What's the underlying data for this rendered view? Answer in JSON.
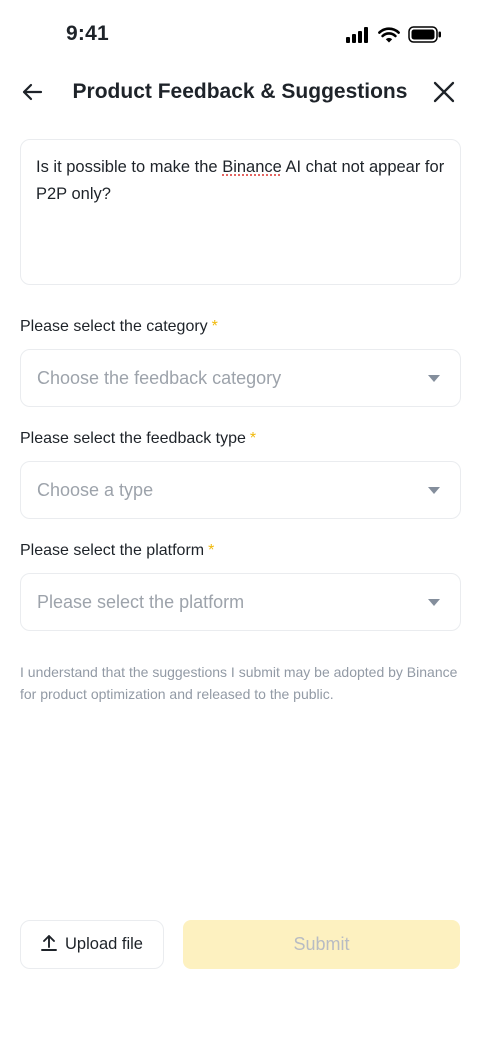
{
  "status_bar": {
    "time": "9:41"
  },
  "header": {
    "title": "Product Feedback & Suggestions",
    "back_icon": "arrow-left-icon",
    "close_icon": "close-icon"
  },
  "feedback": {
    "text_before": "Is it possible to make the ",
    "text_flagged": "Binance",
    "text_after": " AI chat not appear for P2P only?"
  },
  "fields": [
    {
      "label": "Please select the category",
      "required_mark": "*",
      "placeholder": "Choose the feedback category"
    },
    {
      "label": "Please select the feedback type",
      "required_mark": "*",
      "placeholder": "Choose a type"
    },
    {
      "label": "Please select the platform",
      "required_mark": "*",
      "placeholder": "Please select the platform"
    }
  ],
  "disclaimer": "I understand that the suggestions I submit may be adopted by Binance for product optimization and released to the public.",
  "actions": {
    "upload_label": "Upload file",
    "submit_label": "Submit"
  },
  "colors": {
    "accent": "#f0b90b",
    "submit_disabled_bg": "#fdf1c0",
    "border": "#eaecef",
    "placeholder": "#9da3ab"
  }
}
